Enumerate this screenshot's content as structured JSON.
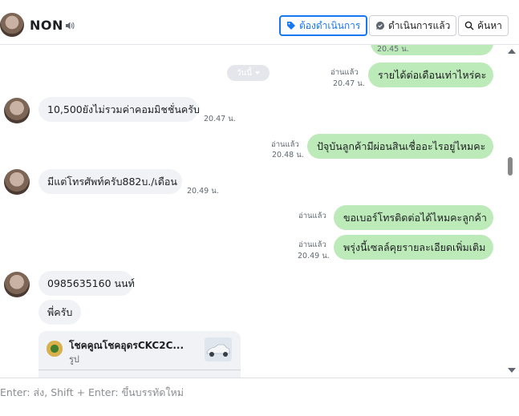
{
  "header": {
    "contact_name": "NON",
    "buttons": {
      "pending": "ต้องดำเนินการ",
      "done": "ดำเนินการแล้ว",
      "search": "ค้นหา"
    }
  },
  "chat": {
    "partial_top_time": "20.45 น.",
    "date_pill": "วันนี้",
    "messages": [
      {
        "dir": "out",
        "text": "รายได้ต่อเดือนเท่าไหร่คะ",
        "read": "อ่านแล้ว",
        "time": "20.47 น."
      },
      {
        "dir": "in",
        "text": "10,500ยังไม่รวมค่าคอมมิชชั่นครับ",
        "time": "20.47 น."
      },
      {
        "dir": "out",
        "text": "ปัจุบันลูกค้ามีผ่อนสินเชื่ออะไรอยู่ไหมคะ",
        "read": "อ่านแล้ว",
        "time": "20.48 น."
      },
      {
        "dir": "in",
        "text": "มีแต่โทรศัพท์ครับ882บ./เดือน",
        "time": "20.49 น."
      },
      {
        "dir": "out",
        "text": "ขอเบอร์โทรติดต่อได้ไหมคะลูกค้า",
        "read": "อ่านแล้ว"
      },
      {
        "dir": "out",
        "text": "พรุ่งนี้เซลล์คุยรายละเอียดเพิ่มเติม",
        "read": "อ่านแล้ว",
        "time": "20.49 น."
      },
      {
        "dir": "in",
        "text": "0985635160 นนท์"
      },
      {
        "dir": "in",
        "text": "พี่ครับ"
      }
    ],
    "card": {
      "title": "โชคคูณโชคอุดรCKC2C...",
      "subtitle": "รูป"
    }
  },
  "composer": {
    "placeholder": "Enter: ส่ง, Shift + Enter: ขึ้นบรรทัดใหม่"
  },
  "colors": {
    "outgoing_bubble": "#bdeab9",
    "incoming_bubble": "#f0f2f5",
    "accent": "#1877f2"
  },
  "icons": [
    "speaker-icon",
    "tag-icon",
    "chat-check-icon",
    "search-icon",
    "chevron-down-icon"
  ]
}
